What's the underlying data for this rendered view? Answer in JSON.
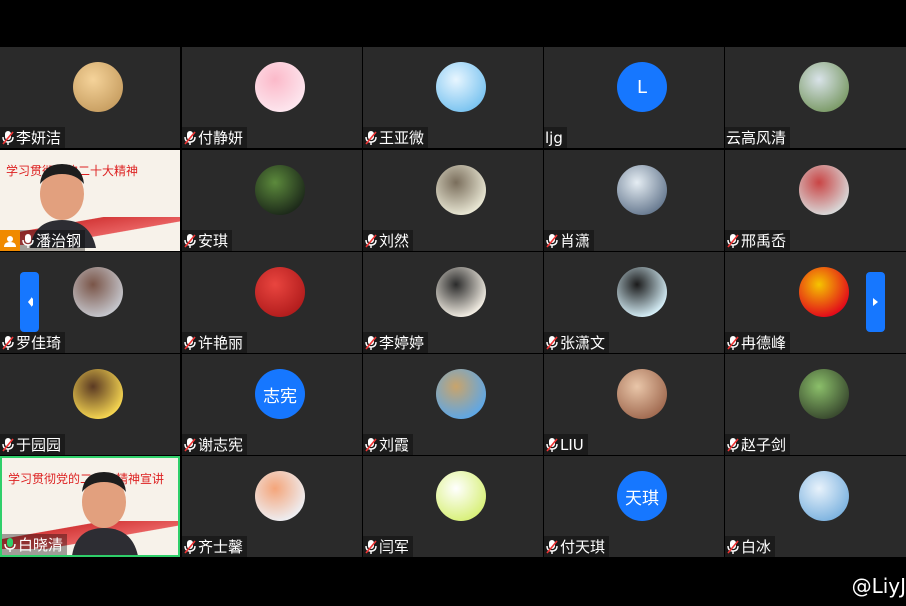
{
  "watermark": "@LiyJ",
  "participants": [
    {
      "name": "李妍洁",
      "avatar": "cartoon-face-avatar",
      "colors": [
        "#c9a063",
        "#f5d39a"
      ]
    },
    {
      "name": "付静妍",
      "avatar": "pink-bunny-avatar",
      "colors": [
        "#fde6ee",
        "#fbb9c9"
      ]
    },
    {
      "name": "王亚微",
      "avatar": "sky-cloud-avatar",
      "colors": [
        "#7cc4f0",
        "#e8f6ff"
      ]
    },
    {
      "name": "ljg",
      "avatar": "letter-avatar",
      "letter": "L",
      "colors": [
        "#1677ff"
      ]
    },
    {
      "name": "云高风清",
      "avatar": "building-photo-avatar",
      "colors": [
        "#7d9c6a",
        "#d9e3e9"
      ]
    },
    {
      "name": "潘治钢",
      "avatar": "video-feed",
      "banner": "学习贯彻党的二十大精神",
      "host": true
    },
    {
      "name": "安琪",
      "avatar": "anime-character-avatar",
      "colors": [
        "#1d2a1a",
        "#5c8a3c"
      ]
    },
    {
      "name": "刘然",
      "avatar": "girl-illustration-avatar",
      "colors": [
        "#e9e7d4",
        "#7a6e5c"
      ]
    },
    {
      "name": "肖潇",
      "avatar": "mountain-photo-avatar",
      "colors": [
        "#6a7c92",
        "#e5edf3"
      ]
    },
    {
      "name": "邢禹岙",
      "avatar": "toy-photo-avatar",
      "colors": [
        "#d8d8d8",
        "#c94545"
      ]
    },
    {
      "name": "罗佳琦",
      "avatar": "person-photo-avatar",
      "colors": [
        "#c5c6cc",
        "#7a5548"
      ]
    },
    {
      "name": "许艳丽",
      "avatar": "red-heart-avatar",
      "colors": [
        "#b31d1d",
        "#e9453f"
      ]
    },
    {
      "name": "李婷婷",
      "avatar": "girl-drawing-avatar",
      "colors": [
        "#f2ede3",
        "#2b2b2b"
      ]
    },
    {
      "name": "张潇文",
      "avatar": "panda-avatar",
      "colors": [
        "#d5eef7",
        "#1b1b1b"
      ]
    },
    {
      "name": "冉德峰",
      "avatar": "dragon-emblem-avatar",
      "colors": [
        "#e20a1a",
        "#f5c400"
      ]
    },
    {
      "name": "于园园",
      "avatar": "cartoon-girl-avatar",
      "colors": [
        "#f6d651",
        "#5b3a23"
      ]
    },
    {
      "name": "谢志宪",
      "avatar": "letter-avatar",
      "letter": "志宪",
      "colors": [
        "#1677ff"
      ]
    },
    {
      "name": "刘霞",
      "avatar": "colosseum-photo-avatar",
      "colors": [
        "#5ea7e6",
        "#c9a46b"
      ]
    },
    {
      "name": "LIU",
      "avatar": "flowers-photo-avatar",
      "colors": [
        "#a26c52",
        "#e9c6a9"
      ]
    },
    {
      "name": "赵子剑",
      "avatar": "anime-boy-avatar",
      "colors": [
        "#3a4b2f",
        "#8bbf6a"
      ]
    },
    {
      "name": "白晓清",
      "avatar": "video-feed",
      "banner": "学习贯彻党的二十大精神宣讲",
      "speaking": true
    },
    {
      "name": "齐士馨",
      "avatar": "cartoon-baby-avatar",
      "colors": [
        "#eeeef2",
        "#f4a57a"
      ]
    },
    {
      "name": "闫军",
      "avatar": "cockatoo-avatar",
      "colors": [
        "#d8f07a",
        "#ffffff"
      ]
    },
    {
      "name": "付天琪",
      "avatar": "letter-avatar",
      "letter": "天琪",
      "colors": [
        "#1677ff"
      ]
    },
    {
      "name": "白冰",
      "avatar": "seagull-photo-avatar",
      "colors": [
        "#7fb4e0",
        "#e8f2fb"
      ]
    }
  ],
  "nav": {
    "prev_label": "‹",
    "next_label": "›"
  }
}
